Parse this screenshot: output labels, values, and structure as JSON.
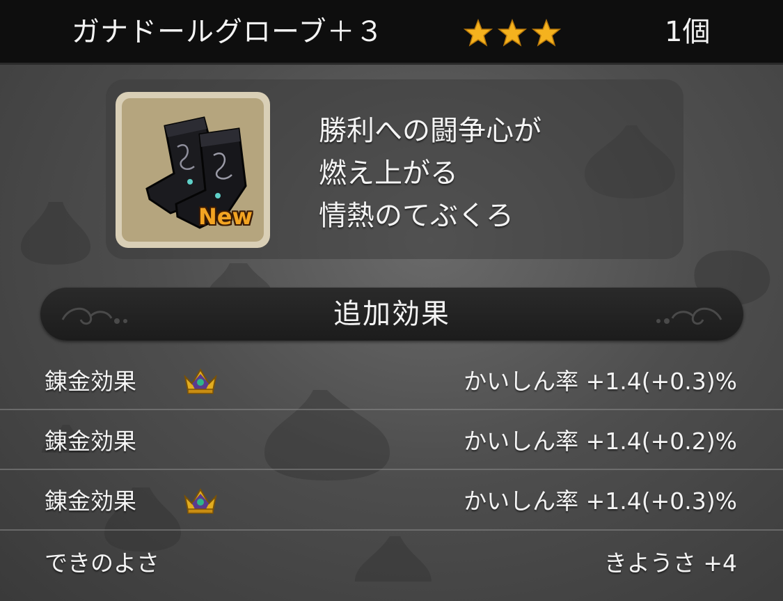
{
  "header": {
    "item_name": "ガナドールグローブ＋３",
    "rarity_stars": 3,
    "quantity": "1個",
    "star_icon": "star-icon"
  },
  "item": {
    "icon": "gloves-icon",
    "new_badge": "New",
    "description": [
      "勝利への闘争心が",
      "燃え上がる",
      "情熱のてぶくろ"
    ]
  },
  "section": {
    "title": "追加効果"
  },
  "effects": [
    {
      "label": "錬金効果",
      "crown": true,
      "value": "かいしん率  +1.4(+0.3)%"
    },
    {
      "label": "錬金効果",
      "crown": false,
      "value": "かいしん率  +1.4(+0.2)%"
    },
    {
      "label": "錬金効果",
      "crown": true,
      "value": "かいしん率  +1.4(+0.3)%"
    },
    {
      "label": "できのよさ",
      "crown": false,
      "value": "きようさ  +4"
    }
  ],
  "colors": {
    "header_bg": "#0e0e0e",
    "star": "#f5b21e",
    "icon_bg": "#b5a57e",
    "new_badge": "#f3a422",
    "crown_gold": "#e3ad1f",
    "crown_purple": "#5b3b8c"
  }
}
